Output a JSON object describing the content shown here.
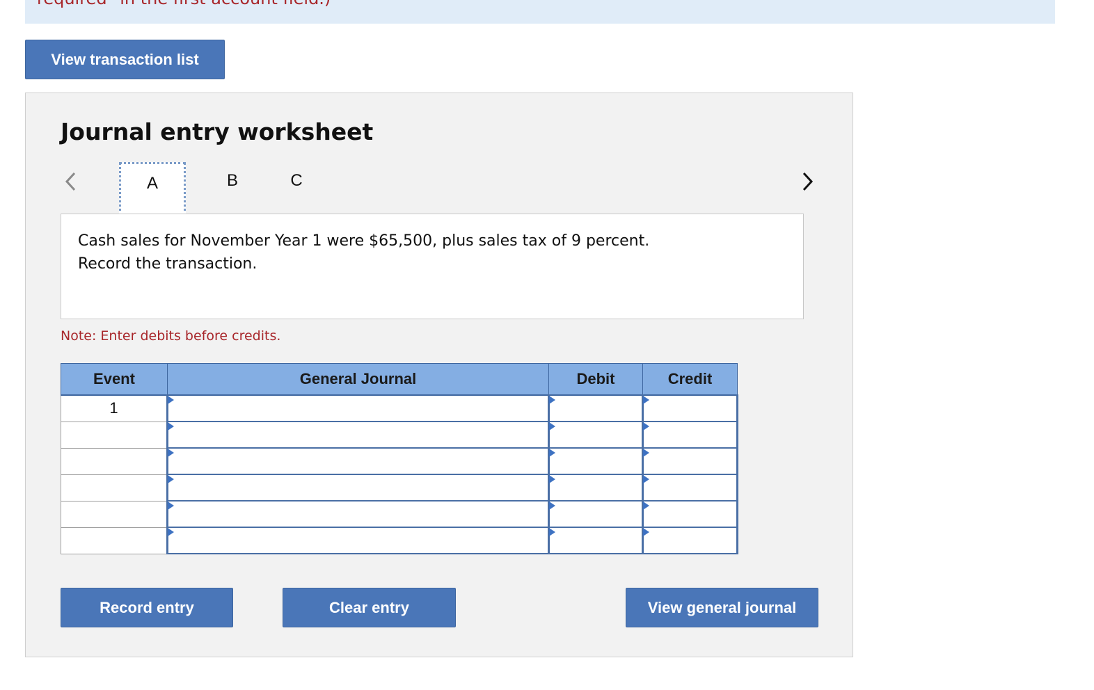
{
  "banner": {
    "text": "required\" in the first account field.)"
  },
  "view_transaction_list_label": "View transaction list",
  "worksheet": {
    "title": "Journal entry worksheet",
    "tabs": [
      {
        "label": "A",
        "active": true
      },
      {
        "label": "B",
        "active": false
      },
      {
        "label": "C",
        "active": false
      }
    ],
    "question_line1": "Cash sales for November Year 1 were $65,500, plus sales tax of 9 percent.",
    "question_line2": "Record the transaction.",
    "note": "Note: Enter debits before credits.",
    "table": {
      "headers": [
        "Event",
        "General Journal",
        "Debit",
        "Credit"
      ],
      "rows": [
        {
          "event": "1",
          "account": "",
          "debit": "",
          "credit": ""
        },
        {
          "event": "",
          "account": "",
          "debit": "",
          "credit": ""
        },
        {
          "event": "",
          "account": "",
          "debit": "",
          "credit": ""
        },
        {
          "event": "",
          "account": "",
          "debit": "",
          "credit": ""
        },
        {
          "event": "",
          "account": "",
          "debit": "",
          "credit": ""
        },
        {
          "event": "",
          "account": "",
          "debit": "",
          "credit": ""
        }
      ]
    },
    "buttons": {
      "record": "Record entry",
      "clear": "Clear entry",
      "view_general_journal": "View general journal"
    }
  },
  "colors": {
    "button": "#4a76b8",
    "header": "#84aee3",
    "note": "#a8262a",
    "banner": "#e0ecf8",
    "panel": "#f2f2f2"
  },
  "icons": {
    "prev": "chevron-left-icon",
    "next": "chevron-right-icon",
    "cell_marker": "triangle-right-icon"
  }
}
